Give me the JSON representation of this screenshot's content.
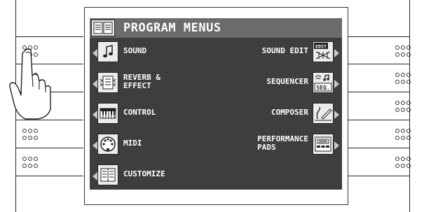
{
  "screen": {
    "title": "PROGRAM MENUS",
    "left_items": [
      {
        "label": "SOUND",
        "icon": "note-icon"
      },
      {
        "label": "REVERB &\nEFFECT",
        "icon": "reverb-effect-icon"
      },
      {
        "label": "CONTROL",
        "icon": "keyboard-icon"
      },
      {
        "label": "MIDI",
        "icon": "midi-connector-icon"
      },
      {
        "label": "CUSTOMIZE",
        "icon": "customize-book-icon"
      }
    ],
    "right_items": [
      {
        "label": "SOUND EDIT",
        "icon": "edit-icon",
        "icon_text": "EDIT"
      },
      {
        "label": "SEQUENCER",
        "icon": "sequencer-icon",
        "icon_text": "SEQ."
      },
      {
        "label": "COMPOSER",
        "icon": "composer-pen-icon"
      },
      {
        "label": "PERFORMANCE\nPADS",
        "icon": "performance-pads-icon"
      }
    ]
  },
  "side_buttons": {
    "left_count": 5,
    "right_count": 5
  },
  "colors": {
    "screen_bg": "#3e3e3e",
    "title_bar": "#6b6b6b",
    "icon_bg": "#ececec"
  }
}
